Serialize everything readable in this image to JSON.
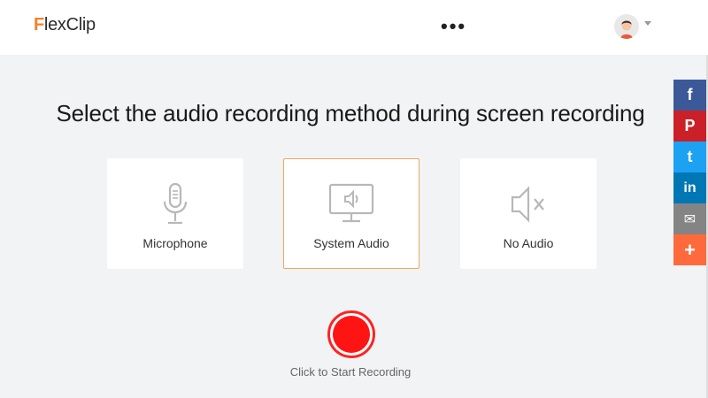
{
  "header": {
    "logo_text": "lexClip",
    "logo_mark": "F",
    "more_label": "•••",
    "avatar": "user-avatar",
    "caret": "chevron-down-icon"
  },
  "main": {
    "title": "Select the audio recording method during screen recording",
    "options": [
      {
        "label": "Microphone",
        "icon": "microphone-icon",
        "selected": false
      },
      {
        "label": "System Audio",
        "icon": "system-audio-icon",
        "selected": true
      },
      {
        "label": "No Audio",
        "icon": "mute-icon",
        "selected": false
      }
    ],
    "record_hint": "Click to Start Recording"
  },
  "share": {
    "items": [
      {
        "name": "facebook",
        "glyph": "f",
        "color": "#3b5998"
      },
      {
        "name": "pinterest",
        "glyph": "P",
        "color": "#cb2027"
      },
      {
        "name": "twitter",
        "glyph": "t",
        "color": "#1da1f2"
      },
      {
        "name": "linkedin",
        "glyph": "in",
        "color": "#0077b5"
      },
      {
        "name": "email",
        "glyph": "✉",
        "color": "#848484"
      },
      {
        "name": "more",
        "glyph": "+",
        "color": "#ff6a3d"
      }
    ]
  },
  "colors": {
    "accent": "#f0822a",
    "selected_border": "#f0a65c",
    "record": "#ff1414",
    "background": "#f1f3f4"
  }
}
